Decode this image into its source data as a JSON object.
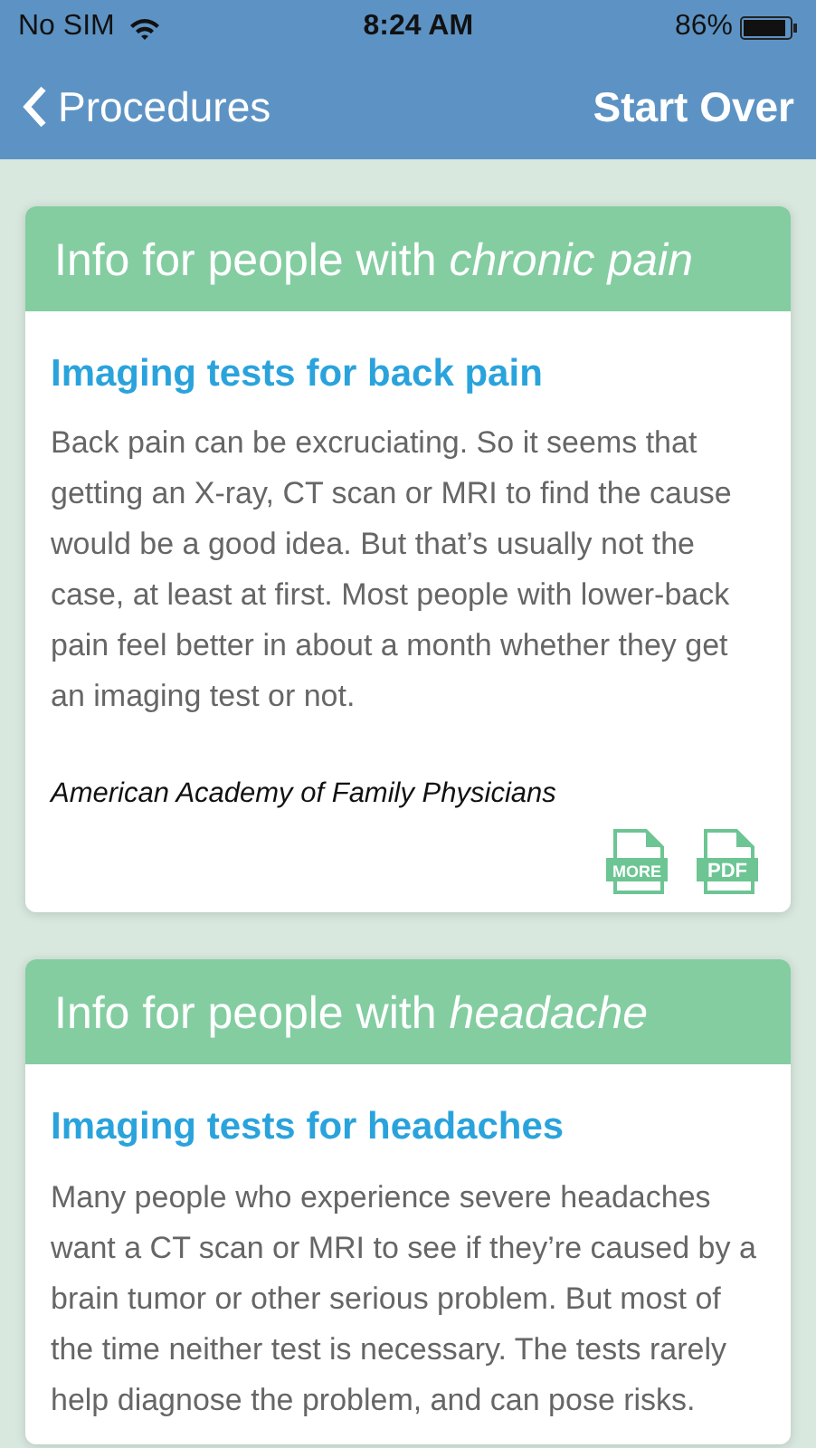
{
  "status_bar": {
    "carrier": "No SIM",
    "time": "8:24 AM",
    "battery": "86%"
  },
  "nav": {
    "back_label": "Procedures",
    "action": "Start Over"
  },
  "cards": [
    {
      "header": "Info for people with *chronic pain*",
      "title": "Imaging tests for back pain",
      "body": "Back pain can be excruciating. So it seems that getting an X-ray, CT scan or MRI to find the cause would be a good idea. But that’s usually not the case, at least at first. Most people with lower-back pain feel better in about a month whether they get an imaging test or not.",
      "source": "American Academy of Family Physicians",
      "files": [
        "MORE",
        "PDF"
      ]
    },
    {
      "header": "Info for people with *headache*",
      "title": "Imaging tests for headaches",
      "body": "Many people who experience severe headaches want a CT scan or MRI to see if they’re caused by a brain tumor or other serious problem. But most of the time neither test is necessary. The tests rarely help diagnose the problem, and can pose risks."
    }
  ]
}
